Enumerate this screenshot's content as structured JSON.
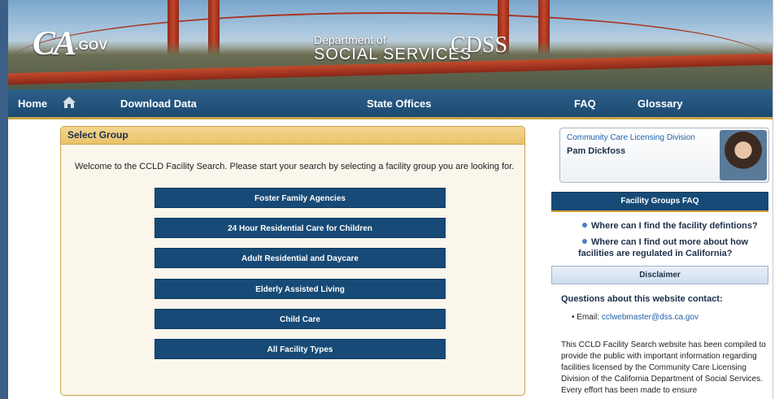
{
  "header": {
    "logo_main": "CA",
    "logo_suffix": ".GOV",
    "dept_line1": "Department of",
    "dept_line2": "SOCIAL SERVICES",
    "cdss": "CDSS"
  },
  "nav": {
    "home": "Home",
    "download": "Download Data",
    "state_offices": "State Offices",
    "faq": "FAQ",
    "glossary": "Glossary"
  },
  "select_group": {
    "title": "Select Group",
    "welcome": "Welcome to the CCLD Facility Search. Please start your search by selecting a facility group you are looking for.",
    "buttons": [
      "Foster Family Agencies",
      "24 Hour Residential Care for Children",
      "Adult Residential and Daycare",
      "Elderly Assisted Living",
      "Child Care",
      "All Facility Types"
    ]
  },
  "profile": {
    "division": "Community Care Licensing Division",
    "name": "Pam Dickfoss"
  },
  "faq_panel": {
    "title": "Facility Groups FAQ",
    "q1": "Where can I find the facility defintions?",
    "q2_line1": "Where can I find out more about how",
    "q2_line2": "facilities are regulated in California?"
  },
  "disclaimer": {
    "title": "Disclaimer",
    "questions": "Questions about this website contact:",
    "email_label": "Email:",
    "email": "cclwebmaster@dss.ca.gov",
    "paragraph": "This CCLD Facility Search website has been compiled to provide the public with important information regarding facilities licensed by the Community Care Licensing Division of the California Department of Social Services. Every effort has been made to ensure"
  },
  "colors": {
    "nav_blue": "#1d4a72",
    "button_blue": "#174a76",
    "gold": "#c9a446"
  }
}
